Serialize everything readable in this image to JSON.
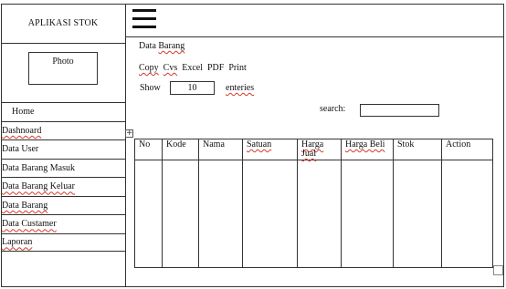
{
  "sidebar": {
    "brand": "APLIKASI STOK",
    "photo_label": "Photo",
    "items": [
      {
        "label": "Home"
      },
      {
        "label": "Dashnoard"
      },
      {
        "label": "Data User"
      },
      {
        "label": "Data Barang Masuk"
      },
      {
        "label": "Data Barang Keluar"
      },
      {
        "label": "Data Barang"
      },
      {
        "label": "Data Custamer"
      },
      {
        "label": "Laporan"
      }
    ]
  },
  "main": {
    "title": "Data Barang",
    "export_buttons": [
      "Copy",
      "Cvs",
      "Excel",
      "PDF",
      "Print"
    ],
    "show_label": "Show",
    "show_value": "10",
    "entries_label": "enteries",
    "search_label": "search:",
    "search_value": ""
  },
  "table": {
    "columns": [
      "No",
      "Kode",
      "Nama",
      "Satuan",
      "Harga Jual",
      "Harga Beli",
      "Stok",
      "Action"
    ],
    "rows": []
  }
}
